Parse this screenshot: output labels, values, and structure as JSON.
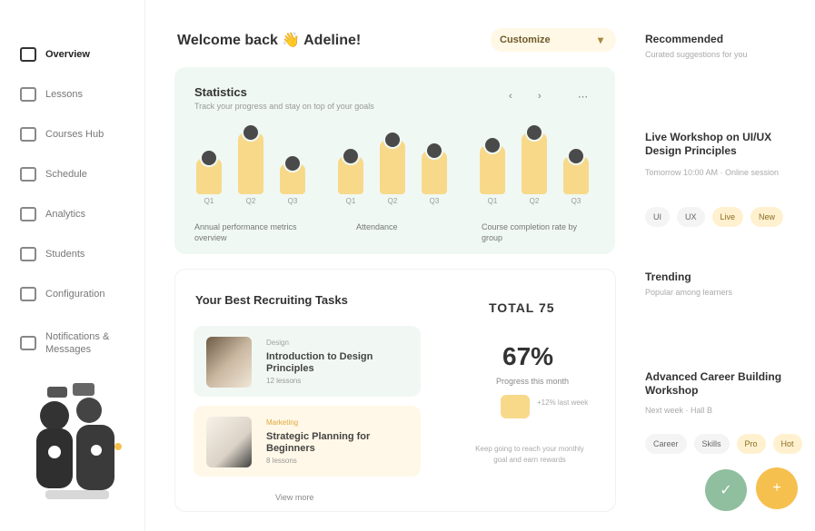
{
  "sidebar": {
    "items": [
      {
        "label": "Overview",
        "icon": "grid-icon"
      },
      {
        "label": "Lessons",
        "icon": "book-icon"
      },
      {
        "label": "Courses Hub",
        "icon": "course-icon"
      },
      {
        "label": "Schedule",
        "icon": "calendar-icon"
      },
      {
        "label": "Analytics",
        "icon": "chart-icon"
      },
      {
        "label": "Students",
        "icon": "users-icon"
      },
      {
        "label": "Configuration",
        "icon": "settings-icon"
      },
      {
        "label": "Notifications & Messages",
        "icon": "message-icon"
      }
    ]
  },
  "header": {
    "greeting": "Welcome back",
    "greeting_emoji": "👋",
    "greeting_name": "Adeline!",
    "calendar_label": "Customize",
    "calendar_chevron": "▾"
  },
  "statistics": {
    "title": "Statistics",
    "subtitle": "Track your progress and stay on top of your goals",
    "prev": "‹",
    "next": "›",
    "more": "⋯",
    "groups": [
      {
        "label": "Annual performance metrics overview",
        "bars": [
          {
            "label": "Q1",
            "value": 40
          },
          {
            "label": "Q2",
            "value": 68
          },
          {
            "label": "Q3",
            "value": 34
          }
        ]
      },
      {
        "label": "Attendance",
        "bars": [
          {
            "label": "Q1",
            "value": 42
          },
          {
            "label": "Q2",
            "value": 60
          },
          {
            "label": "Q3",
            "value": 48
          }
        ]
      },
      {
        "label": "Course completion rate by group",
        "bars": [
          {
            "label": "Q1",
            "value": 54
          },
          {
            "label": "Q2",
            "value": 68
          },
          {
            "label": "Q3",
            "value": 42
          }
        ]
      }
    ]
  },
  "courses": {
    "title": "Your Best Recruiting Tasks",
    "items": [
      {
        "tag": "Design",
        "name": "Introduction to Design Principles",
        "meta": "12 lessons"
      },
      {
        "tag": "Marketing",
        "name": "Strategic Planning for Beginners",
        "meta": "8 lessons"
      }
    ],
    "more": "View more"
  },
  "summary": {
    "total_label": "TOTAL 75",
    "percent": "67%",
    "caption": "Progress this month",
    "mini_text": "+12% last week",
    "description": "Keep going to reach your monthly goal and earn rewards"
  },
  "right": {
    "sec1": {
      "title": "Recommended",
      "sub": "Curated suggestions for you"
    },
    "sec2": {
      "title": "Live Workshop on UI/UX Design Principles",
      "sub": "Tomorrow 10:00 AM · Online session",
      "chips": [
        "UI",
        "UX",
        "Live",
        "New"
      ]
    },
    "sec3": {
      "title": "Trending",
      "sub": "Popular among learners"
    },
    "sec4": {
      "title": "Advanced Career Building Workshop",
      "sub": "Next week · Hall B",
      "chips": [
        "Career",
        "Skills",
        "Pro",
        "Hot"
      ]
    },
    "fab_green": "✓",
    "fab_yellow": "+"
  },
  "colors": {
    "accent_yellow": "#f8d98a",
    "mint_bg": "#eff8f3",
    "green_fab": "#8fbf9e",
    "yellow_fab": "#f6c04f"
  }
}
